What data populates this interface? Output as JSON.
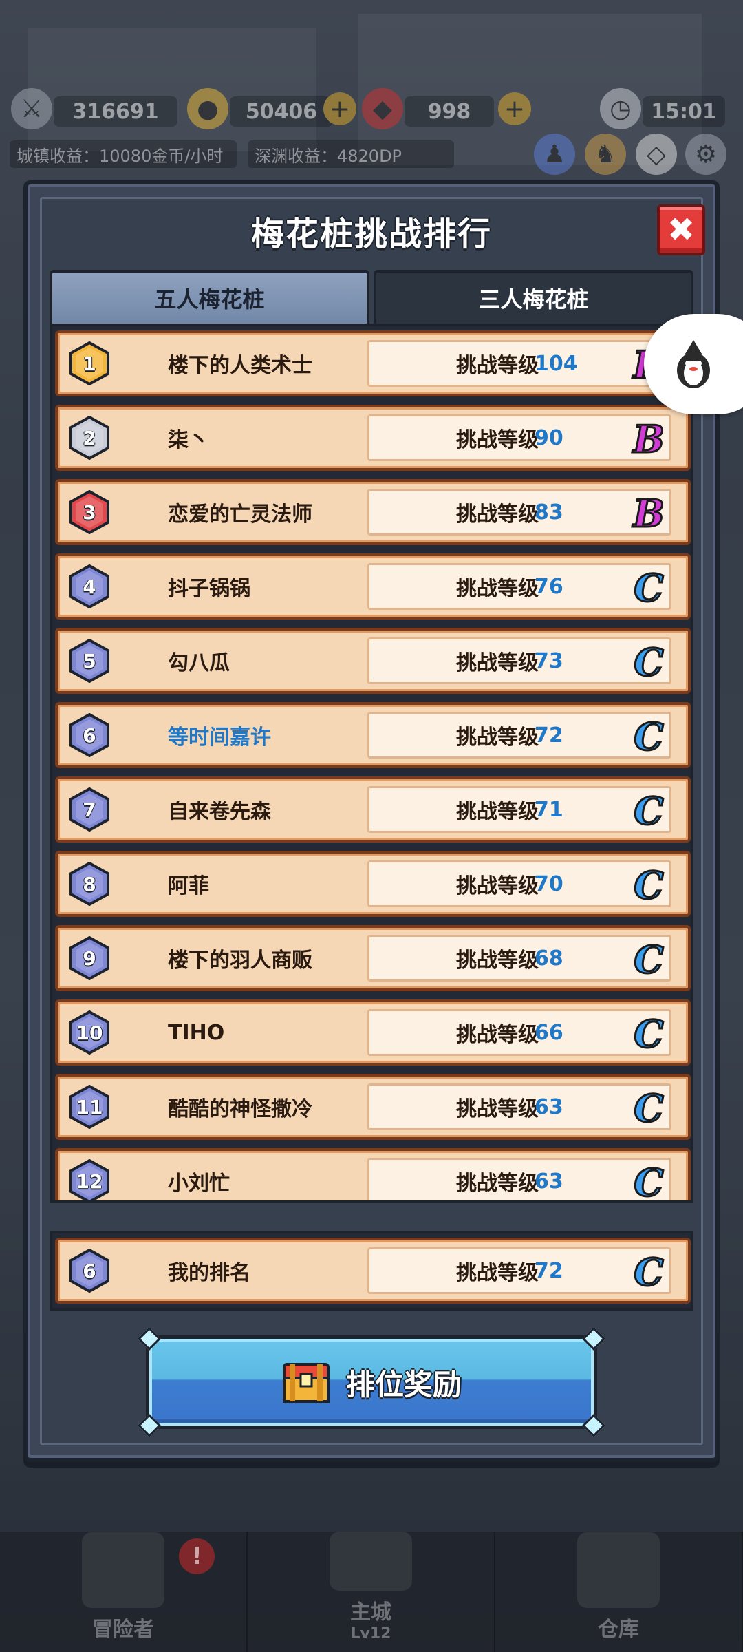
{
  "hud": {
    "power": "316691",
    "gold": "50406",
    "gems": "998",
    "clock": "15:01",
    "town_income": "城镇收益：10080金币/小时",
    "abyss_income": "深渊收益：4820DP"
  },
  "panel": {
    "title": "梅花桩挑战排行",
    "close_icon": "close-icon"
  },
  "tabs": [
    {
      "label": "五人梅花桩",
      "active": true
    },
    {
      "label": "三人梅花桩",
      "active": false
    }
  ],
  "level_prefix": "挑战等级",
  "rankings": [
    {
      "rank": "1",
      "name": "楼下的人类术士",
      "level": "104",
      "grade": "B",
      "badge": "gold"
    },
    {
      "rank": "2",
      "name": "柒丶",
      "level": "90",
      "grade": "B",
      "badge": "silver"
    },
    {
      "rank": "3",
      "name": "恋爱的亡灵法师",
      "level": "83",
      "grade": "B",
      "badge": "red"
    },
    {
      "rank": "4",
      "name": "抖子锅锅",
      "level": "76",
      "grade": "C",
      "badge": "purple"
    },
    {
      "rank": "5",
      "name": "勾八瓜",
      "level": "73",
      "grade": "C",
      "badge": "purple"
    },
    {
      "rank": "6",
      "name": "等时间嘉许",
      "level": "72",
      "grade": "C",
      "badge": "purple",
      "is_self": true
    },
    {
      "rank": "7",
      "name": "自来卷先森",
      "level": "71",
      "grade": "C",
      "badge": "purple"
    },
    {
      "rank": "8",
      "name": "阿菲",
      "level": "70",
      "grade": "C",
      "badge": "purple"
    },
    {
      "rank": "9",
      "name": "楼下的羽人商贩",
      "level": "68",
      "grade": "C",
      "badge": "purple"
    },
    {
      "rank": "10",
      "name": "TIHO",
      "level": "66",
      "grade": "C",
      "badge": "purple"
    },
    {
      "rank": "11",
      "name": "酷酷的神怪撒冷",
      "level": "63",
      "grade": "C",
      "badge": "purple"
    },
    {
      "rank": "12",
      "name": "小刘忙",
      "level": "63",
      "grade": "C",
      "badge": "purple"
    }
  ],
  "my_rank": {
    "rank": "6",
    "name": "我的排名",
    "level": "72",
    "grade": "C",
    "badge": "purple"
  },
  "reward_button": {
    "label": "排位奖励",
    "icon": "treasure-chest-icon"
  },
  "bottom_nav": [
    {
      "label": "冒险者",
      "sub": "",
      "alert": "!"
    },
    {
      "label": "主城",
      "sub": "Lv12",
      "alert": ""
    },
    {
      "label": "仓库",
      "sub": "",
      "alert": ""
    }
  ],
  "colors": {
    "gold": "#f4b63a",
    "silver": "#c9ccd6",
    "red": "#e2474b",
    "purple": "#7e86d6",
    "grade_B": "#d33bd6",
    "grade_C": "#3a9ef0",
    "level_value": "#1f78c8"
  }
}
